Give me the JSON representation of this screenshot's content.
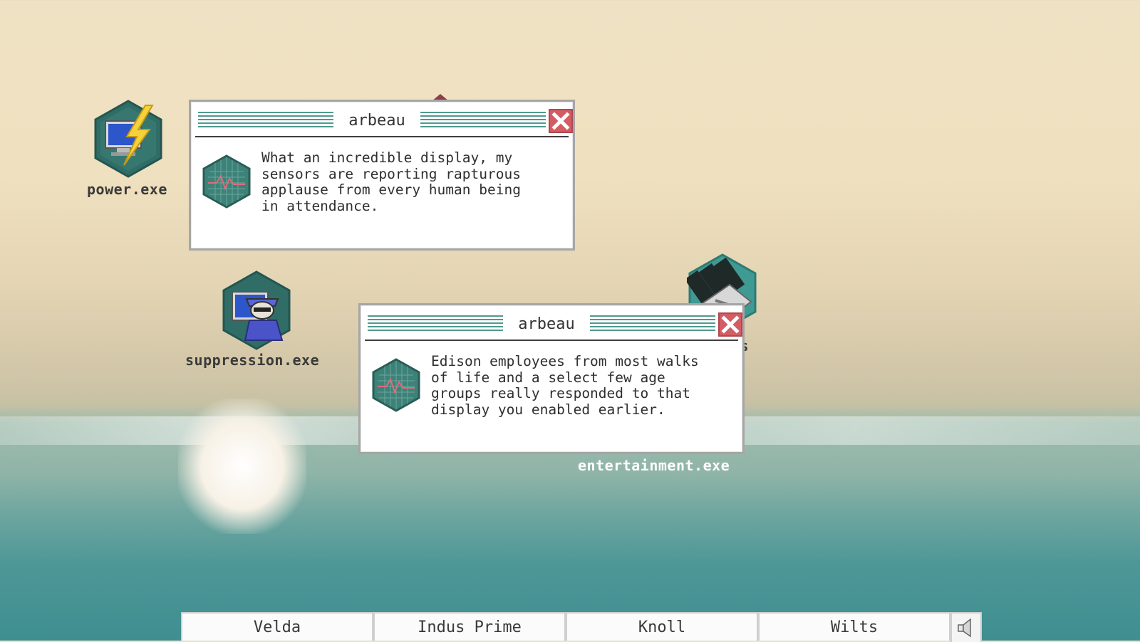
{
  "desktop": {
    "icons": [
      {
        "label": "power.exe",
        "icon": "power-icon"
      },
      {
        "label": "suppression.exe",
        "icon": "suppression-icon"
      },
      {
        "label": "gs",
        "icon": "settings-icon"
      },
      {
        "label": "entertainment.exe",
        "icon": "entertainment-icon"
      }
    ]
  },
  "windows": [
    {
      "title": "arbeau",
      "icon": "waveform-hex-icon",
      "message": "What an incredible display, my\nsensors are reporting rapturous\napplause from every human being\nin attendance."
    },
    {
      "title": "arbeau",
      "icon": "waveform-hex-icon",
      "message": "Edison employees from most walks\nof life and a select few age\ngroups really responded to that\ndisplay you enabled earlier."
    }
  ],
  "taskbar": {
    "tabs": [
      "Velda",
      "Indus Prime",
      "Knoll",
      "Wilts"
    ],
    "speaker_icon": "speaker-icon"
  },
  "colors": {
    "accent_teal": "#4f9a8d",
    "hex_dark": "#2f6d66",
    "close_red": "#d45c63",
    "sky_top": "#efe2c4",
    "sea": "#3f8e90"
  }
}
